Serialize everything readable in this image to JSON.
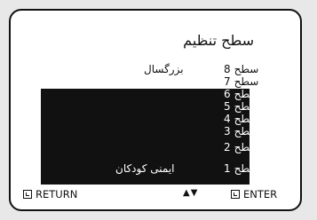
{
  "menu": {
    "title": "سطح تنظیم"
  },
  "levels": [
    {
      "word": "سطح",
      "number": "8",
      "label": "بزرگسال",
      "selected": false
    },
    {
      "word": "سطح",
      "number": "7",
      "label": "",
      "selected": false
    },
    {
      "word": "سطح",
      "number": "6",
      "label": "",
      "selected": true
    },
    {
      "word": "سطح",
      "number": "5",
      "label": "",
      "selected": true
    },
    {
      "word": "سطح",
      "number": "4",
      "label": "",
      "selected": true
    },
    {
      "word": "سطح",
      "number": "3",
      "label": "",
      "selected": true
    },
    {
      "word": "سطح",
      "number": "2",
      "label": "",
      "selected": true
    },
    {
      "word": "سطح",
      "number": "1",
      "label": "ایمنی کودکان",
      "selected": true
    }
  ],
  "footer": {
    "return_label": "RETURN",
    "nav_arrows": "▲▼",
    "enter_label": "ENTER"
  },
  "icons": {
    "return": "return-icon",
    "enter": "enter-icon",
    "arrows": "up-down-arrows-icon"
  },
  "colors": {
    "panel": "#111111",
    "background": "#ffffff",
    "text": "#111111"
  }
}
